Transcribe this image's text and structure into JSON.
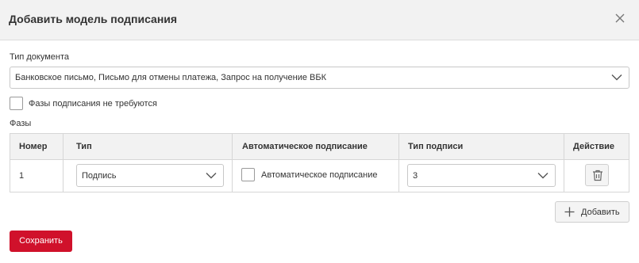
{
  "dialog": {
    "title": "Добавить модель подписания"
  },
  "form": {
    "doc_type_label": "Тип документа",
    "doc_type_value": "Банковское письмо, Письмо для отмены платежа, Запрос на получение ВБК",
    "no_phases_label": "Фазы подписания не требуются",
    "no_phases_checked": false,
    "phases_label": "Фазы"
  },
  "table": {
    "headers": {
      "number": "Номер",
      "type": "Тип",
      "auto_sign": "Автоматическое подписание",
      "sign_type": "Тип подписи",
      "action": "Действие"
    },
    "rows": [
      {
        "number": "1",
        "type": "Подпись",
        "auto_sign_label": "Автоматическое подписание",
        "auto_sign_checked": false,
        "sign_type": "3"
      }
    ]
  },
  "buttons": {
    "add": "Добавить",
    "save": "Сохранить"
  },
  "colors": {
    "primary": "#d0112b",
    "header_bg": "#f2f2f2",
    "border": "#d6d6d6"
  }
}
